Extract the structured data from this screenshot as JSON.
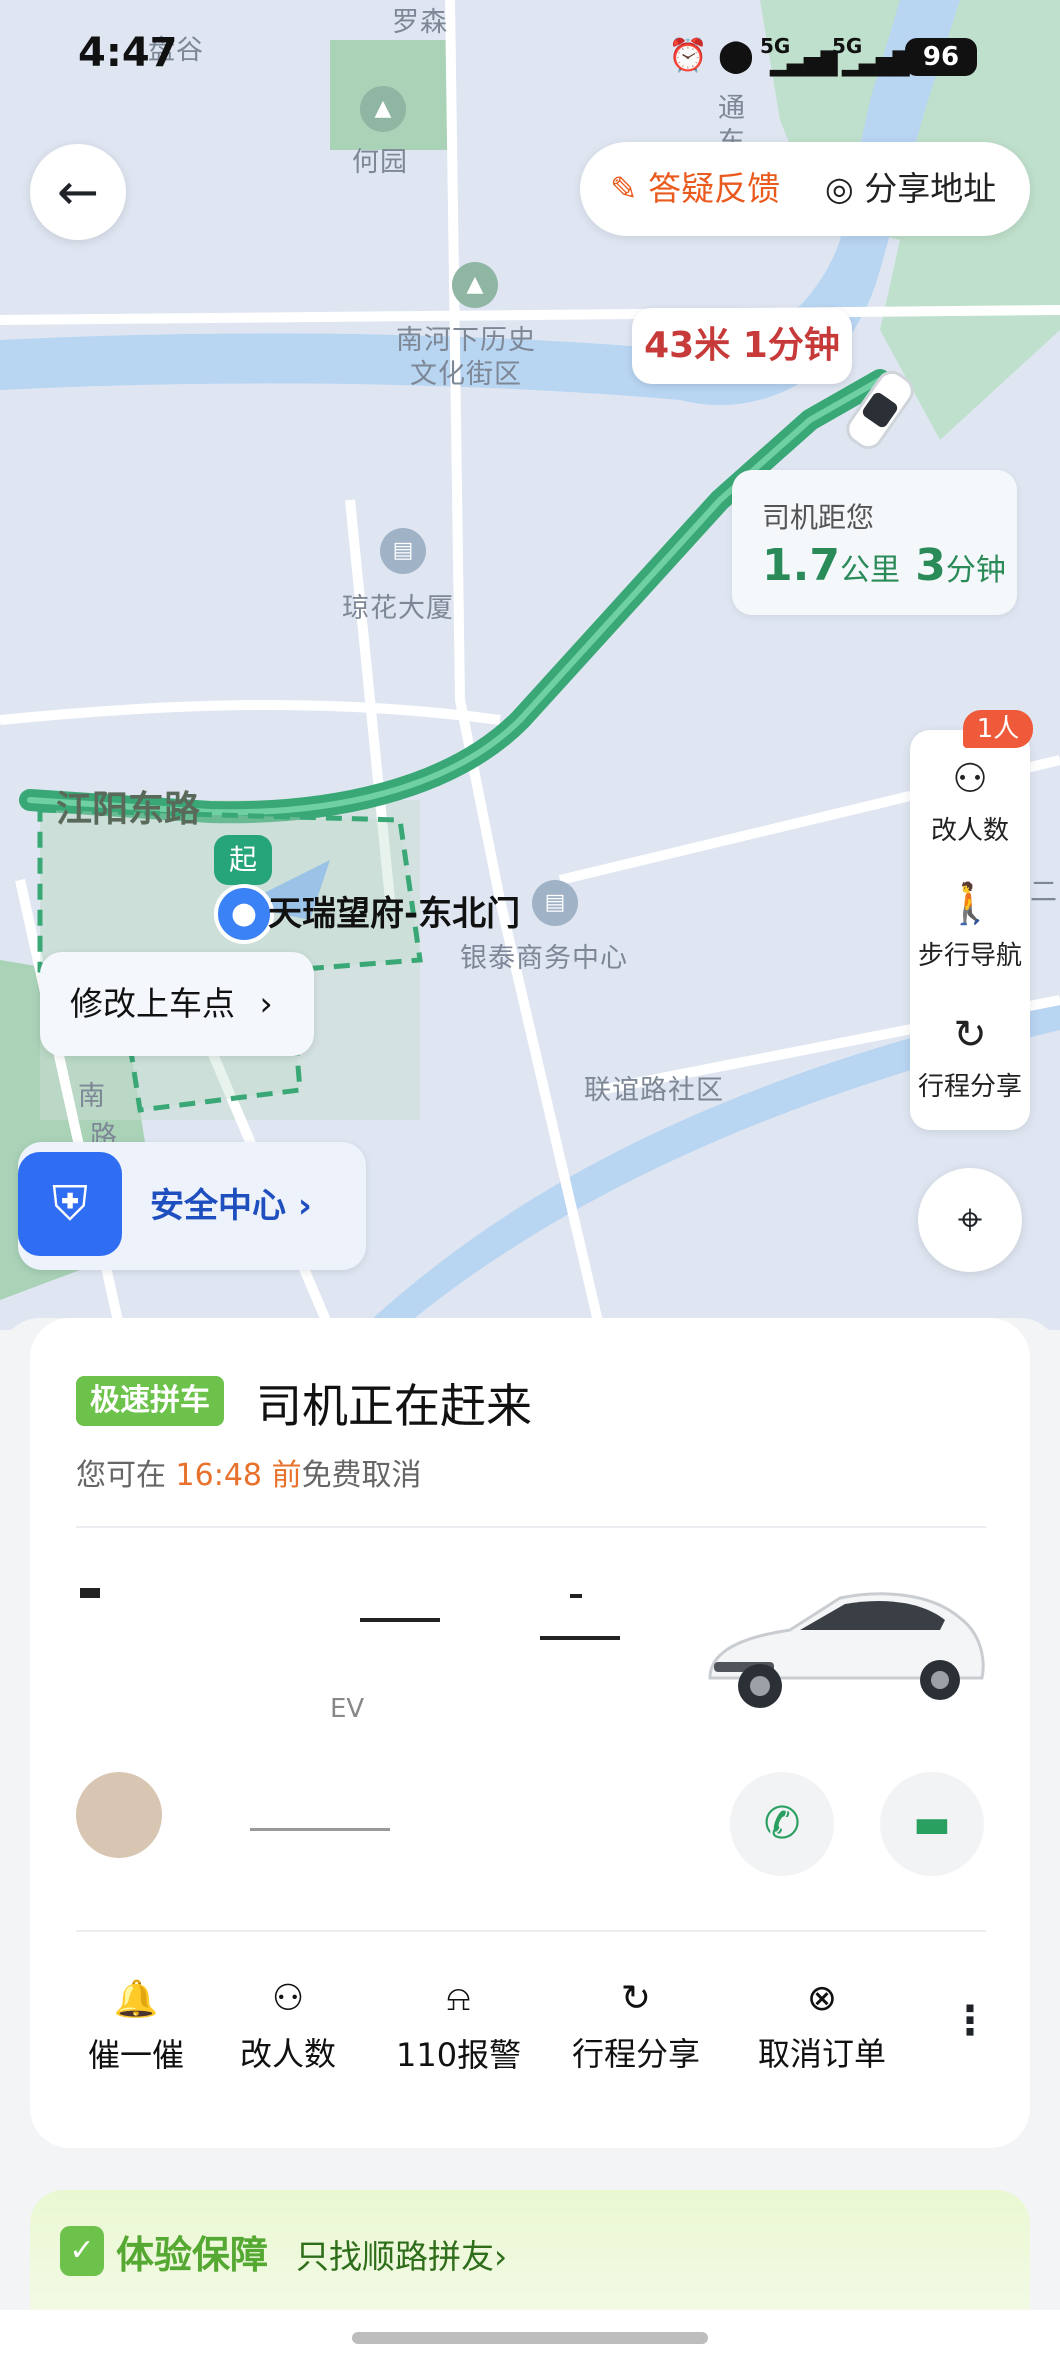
{
  "status_bar": {
    "time": "4:47",
    "signal1": "5G",
    "signal2": "5G",
    "battery": "96"
  },
  "map": {
    "labels": [
      "盘谷",
      "罗森",
      "何园",
      "南河下历史",
      "文化街区",
      "琼花大厦",
      "银泰商务中心",
      "联谊路社区",
      "南",
      "路",
      "通",
      "东",
      "二"
    ],
    "road_name": "江阳东路",
    "car_bubble": {
      "distance_value": "43",
      "distance_unit": "米",
      "time_value": "1",
      "time_unit": "分钟"
    },
    "driver_eta": {
      "title": "司机距您",
      "distance_value": "1.7",
      "distance_unit": "公里",
      "time_value": "3",
      "time_unit": "分钟"
    },
    "pickup": {
      "start_badge": "起",
      "name": "天瑞望府-东北门"
    }
  },
  "top_actions": {
    "faq": "答疑反馈",
    "share_address": "分享地址"
  },
  "side_panel": {
    "people_badge": "1人",
    "items": [
      {
        "label": "改人数",
        "icon": "people-icon"
      },
      {
        "label": "步行导航",
        "icon": "walk-icon"
      },
      {
        "label": "行程分享",
        "icon": "share-icon"
      }
    ]
  },
  "modify_pickup": "修改上车点",
  "safety_center": "安全中心",
  "trip": {
    "tag": "极速拼车",
    "status": "司机正在赶来",
    "cancel_prefix": "您可在",
    "cancel_time": "16:48",
    "cancel_before": "前",
    "cancel_suffix": "免费取消",
    "car_model_partial": "EV",
    "actions": [
      {
        "label": "催一催",
        "icon": "bell-icon"
      },
      {
        "label": "改人数",
        "icon": "people-icon"
      },
      {
        "label": "110报警",
        "icon": "alarm-110-icon"
      },
      {
        "label": "行程分享",
        "icon": "share-icon"
      },
      {
        "label": "取消订单",
        "icon": "cancel-icon"
      }
    ]
  },
  "guarantee": {
    "title": "体验保障",
    "subtitle": "只找顺路拼友›"
  },
  "colors": {
    "route": "#3aa876",
    "accent_orange": "#ea5a1e",
    "safety_blue": "#2f6ef2",
    "tag_green": "#6cc24a"
  }
}
